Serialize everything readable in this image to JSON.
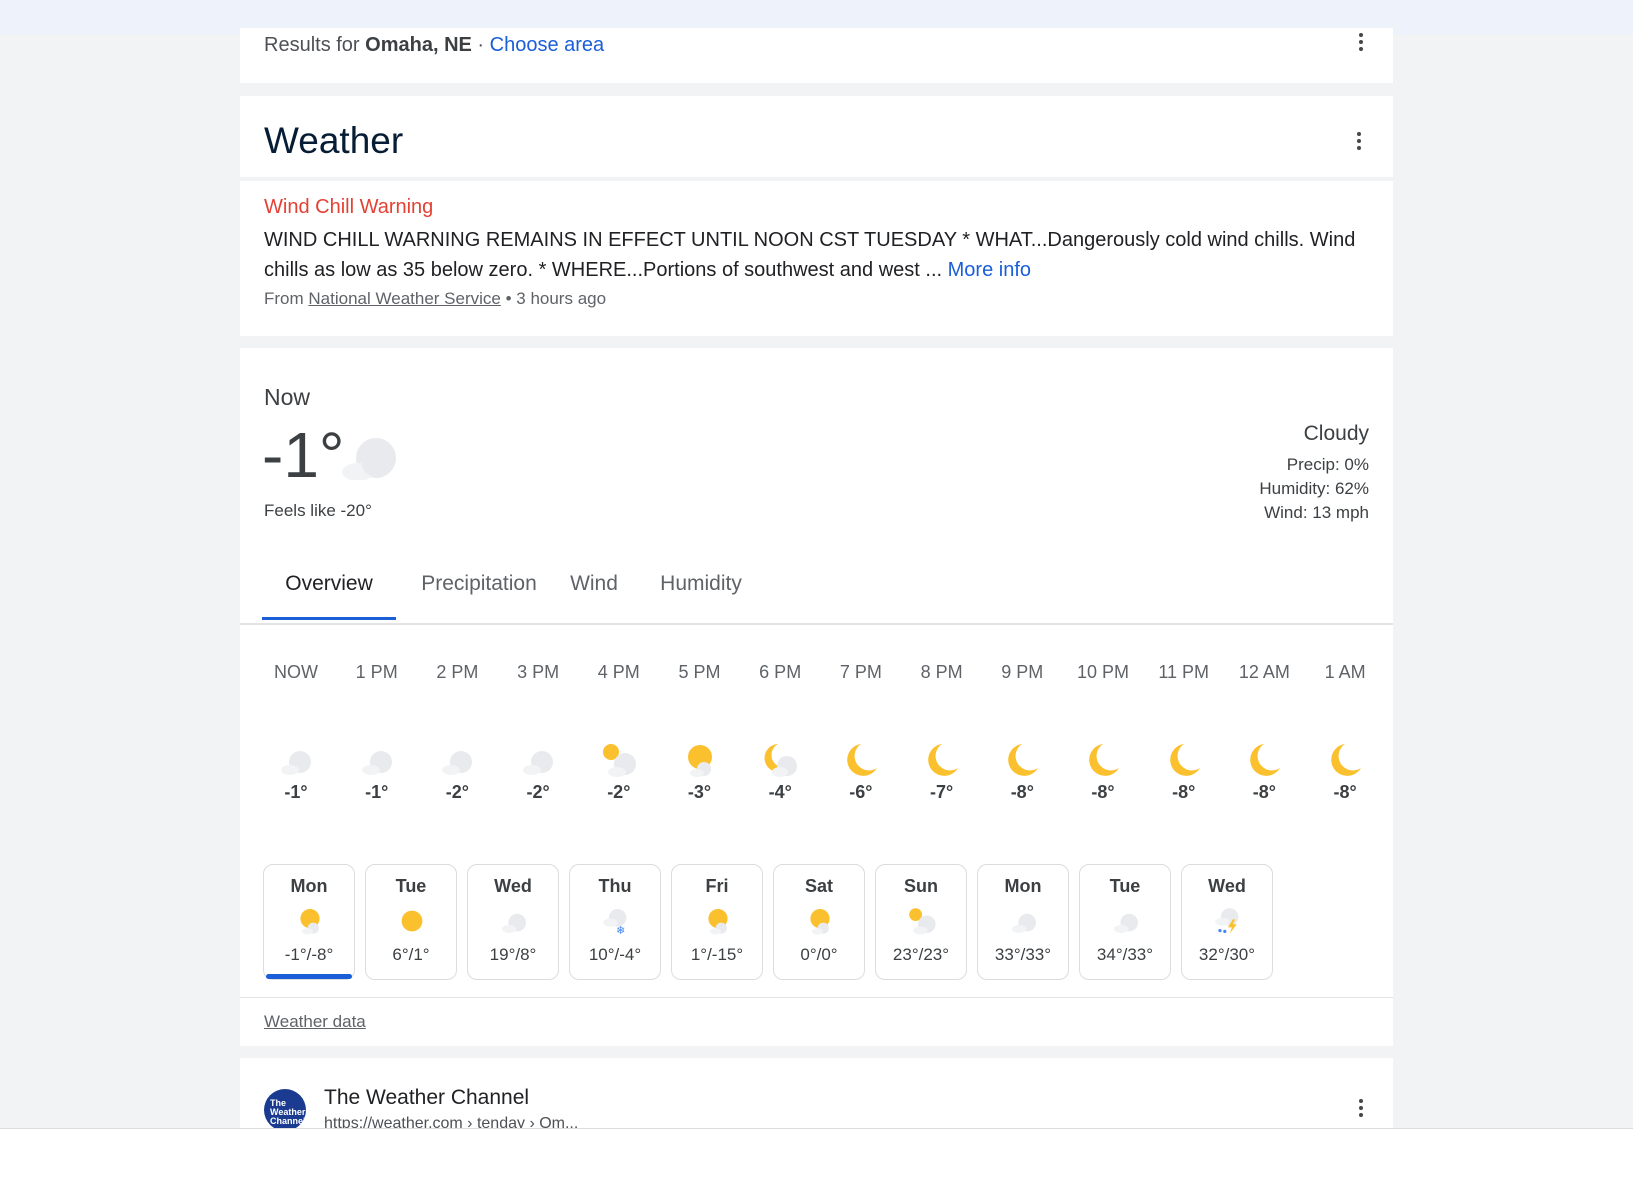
{
  "results": {
    "prefix": "Results for",
    "location": "Omaha, NE",
    "separator": "·",
    "choose_area": "Choose area"
  },
  "weather_header": {
    "title": "Weather"
  },
  "alert": {
    "title": "Wind Chill Warning",
    "body": "WIND CHILL WARNING REMAINS IN EFFECT UNTIL NOON CST TUESDAY * WHAT...Dangerously cold wind chills. Wind chills as low as 35 below zero. * WHERE...Portions of southwest and west ...",
    "more_info": "More info",
    "from_label": "From",
    "source": "National Weather Service",
    "time": "• 3 hours ago"
  },
  "current": {
    "label": "Now",
    "temp": "-1°",
    "feels_like": "Feels like -20°",
    "condition": "Cloudy",
    "precip": "Precip: 0%",
    "humidity": "Humidity: 62%",
    "wind": "Wind: 13 mph",
    "icon": "cloudy-icon"
  },
  "tabs": [
    "Overview",
    "Precipitation",
    "Wind",
    "Humidity"
  ],
  "active_tab": "Overview",
  "hourly": [
    {
      "time": "NOW",
      "temp": "-1°",
      "icon": "cloudy"
    },
    {
      "time": "1 PM",
      "temp": "-1°",
      "icon": "cloudy"
    },
    {
      "time": "2 PM",
      "temp": "-2°",
      "icon": "cloudy"
    },
    {
      "time": "3 PM",
      "temp": "-2°",
      "icon": "cloudy"
    },
    {
      "time": "4 PM",
      "temp": "-2°",
      "icon": "partly-cloudy"
    },
    {
      "time": "5 PM",
      "temp": "-3°",
      "icon": "mostly-sunny"
    },
    {
      "time": "6 PM",
      "temp": "-4°",
      "icon": "partly-cloudy-night"
    },
    {
      "time": "7 PM",
      "temp": "-6°",
      "icon": "clear-night"
    },
    {
      "time": "8 PM",
      "temp": "-7°",
      "icon": "clear-night"
    },
    {
      "time": "9 PM",
      "temp": "-8°",
      "icon": "clear-night"
    },
    {
      "time": "10 PM",
      "temp": "-8°",
      "icon": "clear-night"
    },
    {
      "time": "11 PM",
      "temp": "-8°",
      "icon": "clear-night"
    },
    {
      "time": "12 AM",
      "temp": "-8°",
      "icon": "clear-night"
    },
    {
      "time": "1 AM",
      "temp": "-8°",
      "icon": "clear-night"
    }
  ],
  "daily": [
    {
      "day": "Mon",
      "temps": "-1°/-8°",
      "icon": "mostly-sunny",
      "selected": true
    },
    {
      "day": "Tue",
      "temps": "6°/1°",
      "icon": "sunny"
    },
    {
      "day": "Wed",
      "temps": "19°/8°",
      "icon": "cloudy"
    },
    {
      "day": "Thu",
      "temps": "10°/-4°",
      "icon": "snow"
    },
    {
      "day": "Fri",
      "temps": "1°/-15°",
      "icon": "mostly-sunny"
    },
    {
      "day": "Sat",
      "temps": "0°/0°",
      "icon": "mostly-sunny"
    },
    {
      "day": "Sun",
      "temps": "23°/23°",
      "icon": "partly-cloudy"
    },
    {
      "day": "Mon",
      "temps": "33°/33°",
      "icon": "cloudy"
    },
    {
      "day": "Tue",
      "temps": "34°/33°",
      "icon": "cloudy"
    },
    {
      "day": "Wed",
      "temps": "32°/30°",
      "icon": "thunderstorm"
    }
  ],
  "weather_data_link": "Weather data",
  "source_card": {
    "logo_text": "The Weather Channel",
    "name": "The Weather Channel",
    "url": "https://weather.com › tenday › Om..."
  },
  "colors": {
    "accent": "#1a5ed8",
    "warning": "#e44134",
    "sun": "#fbc02d",
    "cloud": "#dadce0"
  }
}
